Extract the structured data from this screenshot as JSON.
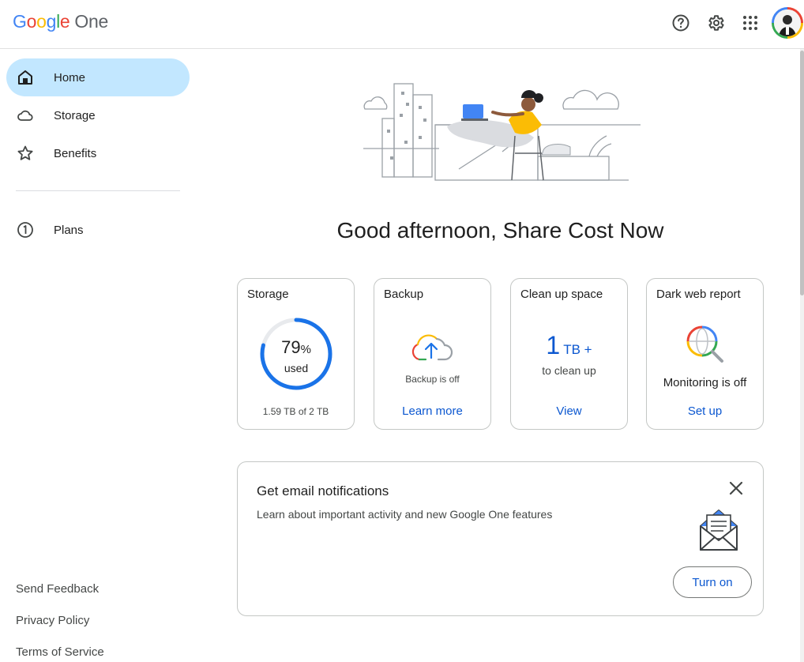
{
  "header": {
    "logo_letters": [
      "G",
      "o",
      "o",
      "g",
      "l",
      "e"
    ],
    "logo_suffix": "One",
    "icons": [
      "help-icon",
      "settings-icon",
      "apps-grid-icon"
    ],
    "avatar": "account-avatar"
  },
  "sidebar": {
    "items": [
      {
        "label": "Home",
        "icon": "home-icon",
        "active": true
      },
      {
        "label": "Storage",
        "icon": "cloud-icon",
        "active": false
      },
      {
        "label": "Benefits",
        "icon": "star-icon",
        "active": false
      },
      {
        "label": "Plans",
        "icon": "plan-one-icon",
        "active": false
      }
    ],
    "footer": [
      "Send Feedback",
      "Privacy Policy",
      "Terms of Service"
    ]
  },
  "main": {
    "greeting": "Good afternoon, Share Cost Now",
    "cards": {
      "storage": {
        "title": "Storage",
        "percent": "79",
        "percent_sign": "%",
        "used_label": "used",
        "used_fraction": 0.79,
        "detail": "1.59 TB of 2 TB"
      },
      "backup": {
        "title": "Backup",
        "status": "Backup is off",
        "link": "Learn more"
      },
      "cleanup": {
        "title": "Clean up space",
        "amount": "1",
        "unit": "TB +",
        "subtitle": "to clean up",
        "link": "View"
      },
      "darkweb": {
        "title": "Dark web report",
        "status": "Monitoring is off",
        "link": "Set up"
      }
    },
    "notification": {
      "title": "Get email notifications",
      "description": "Learn about important activity and new Google One features",
      "button": "Turn on"
    }
  },
  "colors": {
    "accent": "#0b57d0",
    "active_nav": "#c2e7ff",
    "ring": "#1a73e8",
    "ring_track": "#e8eaed"
  }
}
